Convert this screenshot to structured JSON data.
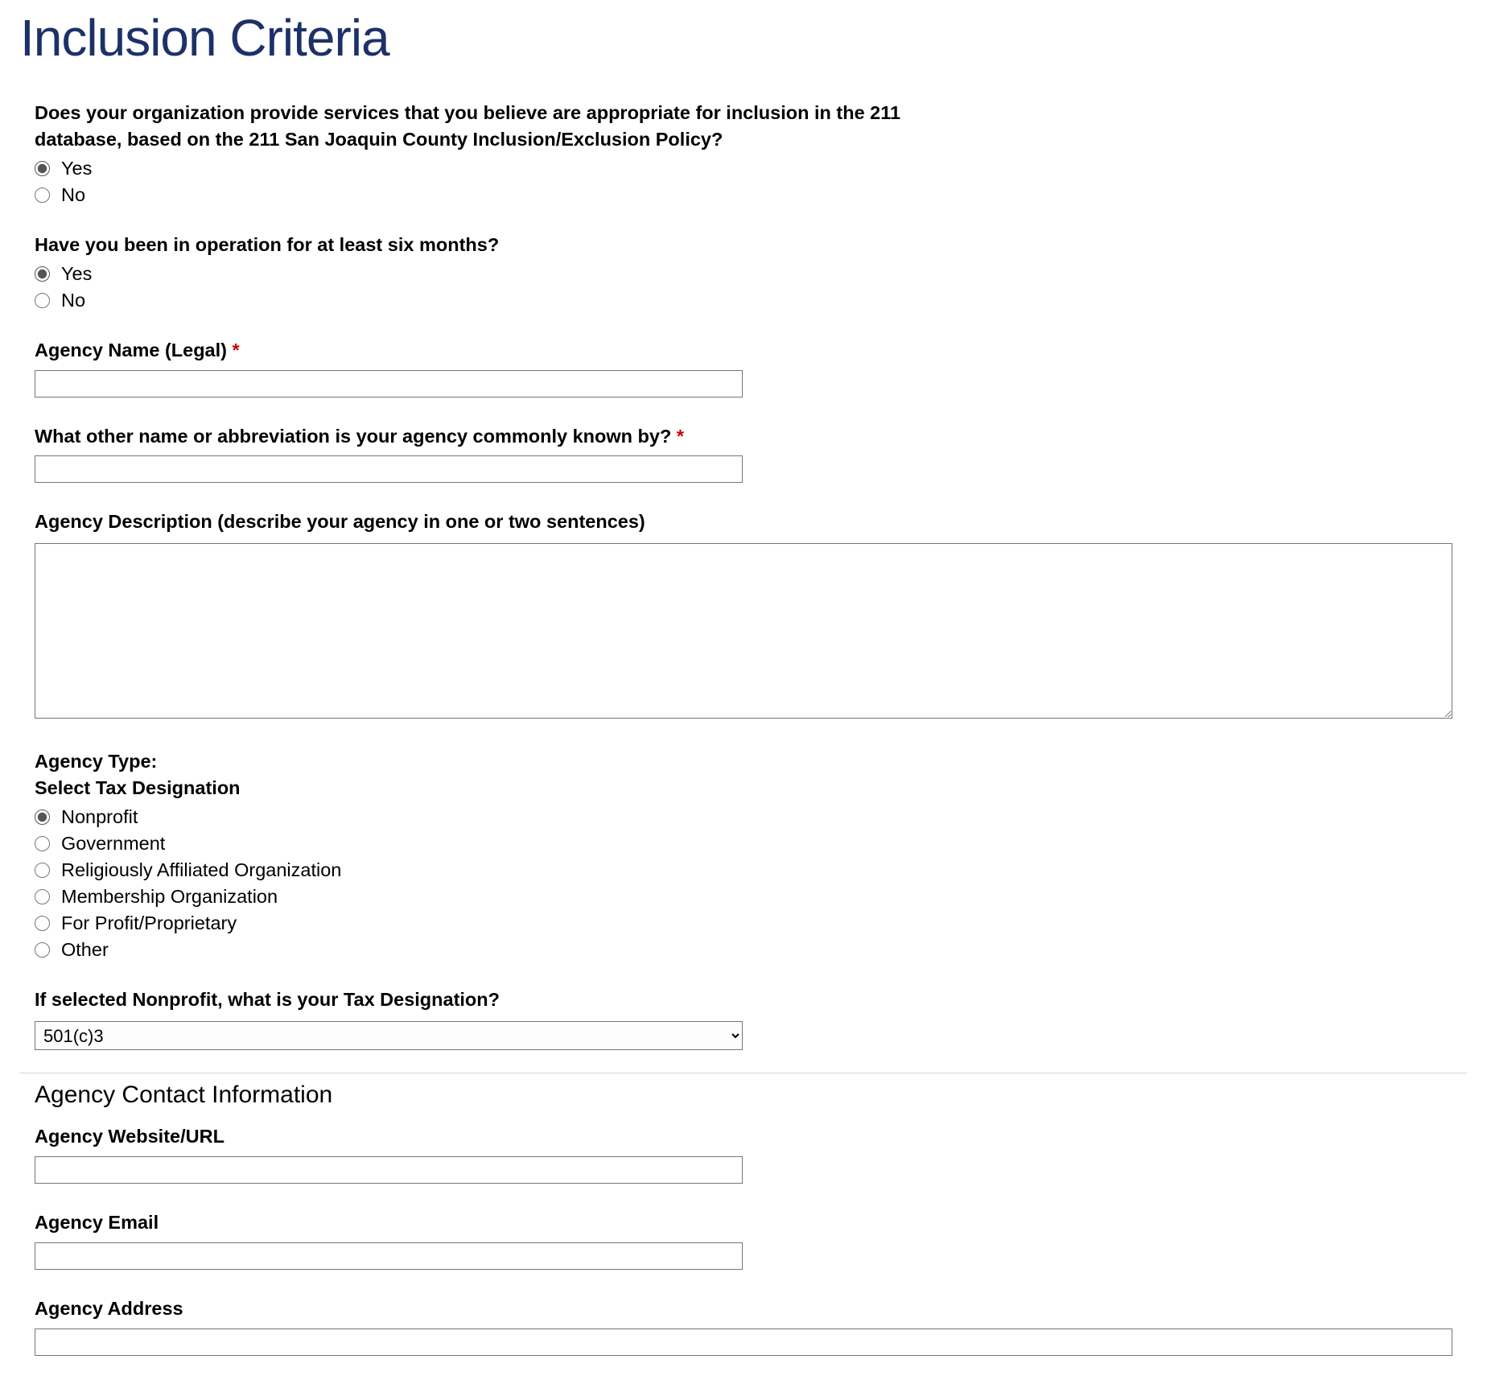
{
  "title": "Inclusion Criteria",
  "q1": {
    "label": "Does your organization provide services that you believe are appropriate for inclusion in the 211 database, based on the 211 San Joaquin County Inclusion/Exclusion Policy?",
    "options": [
      {
        "label": "Yes",
        "checked": true
      },
      {
        "label": "No",
        "checked": false
      }
    ]
  },
  "q2": {
    "label": "Have you been in operation for at least six months?",
    "options": [
      {
        "label": "Yes",
        "checked": true
      },
      {
        "label": "No",
        "checked": false
      }
    ]
  },
  "agency_name": {
    "label": "Agency Name (Legal)",
    "required": true,
    "value": ""
  },
  "other_name": {
    "label": "What other name or abbreviation is your agency commonly known by?",
    "required": true,
    "value": ""
  },
  "description": {
    "label": "Agency Description (describe your agency in one or two sentences)",
    "value": ""
  },
  "agency_type": {
    "label_line1": "Agency Type:",
    "label_line2": "Select Tax Designation",
    "options": [
      {
        "label": "Nonprofit",
        "checked": true
      },
      {
        "label": "Government",
        "checked": false
      },
      {
        "label": "Religiously Affiliated Organization",
        "checked": false
      },
      {
        "label": "Membership Organization",
        "checked": false
      },
      {
        "label": "For Profit/Proprietary",
        "checked": false
      },
      {
        "label": "Other",
        "checked": false
      }
    ]
  },
  "tax_designation": {
    "label": "If selected Nonprofit, what is your Tax Designation?",
    "selected": "501(c)3"
  },
  "contact_section": {
    "heading": "Agency Contact Information",
    "website": {
      "label": "Agency Website/URL",
      "value": ""
    },
    "email": {
      "label": "Agency Email",
      "value": ""
    },
    "address": {
      "label": "Agency Address",
      "value": ""
    }
  },
  "required_marker": "*"
}
